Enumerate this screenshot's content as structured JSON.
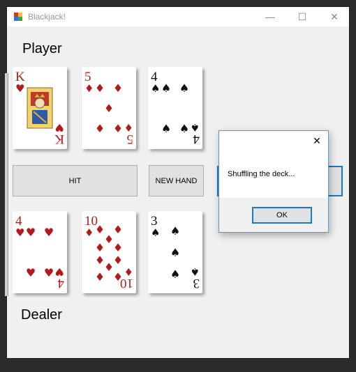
{
  "window": {
    "title": "Blackjack!",
    "minimize_glyph": "—",
    "maximize_glyph": "☐",
    "close_glyph": "✕"
  },
  "labels": {
    "player": "Player",
    "dealer": "Dealer"
  },
  "buttons": {
    "hit": "HIT",
    "new_hand": "NEW HAND"
  },
  "player_cards": [
    {
      "rank": "K",
      "suit": "♥",
      "color": "#b31b1b",
      "face": true
    },
    {
      "rank": "5",
      "suit": "♦",
      "color": "#b31b1b",
      "face": false
    },
    {
      "rank": "4",
      "suit": "♠",
      "color": "#111111",
      "face": false
    }
  ],
  "dealer_cards": [
    {
      "rank": "4",
      "suit": "♥",
      "color": "#b31b1b",
      "face": false
    },
    {
      "rank": "10",
      "suit": "♦",
      "color": "#b31b1b",
      "face": false
    },
    {
      "rank": "3",
      "suit": "♠",
      "color": "#111111",
      "face": false
    }
  ],
  "dialog": {
    "message": "Shuffling the deck...",
    "ok_label": "OK",
    "close_glyph": "✕"
  },
  "colors": {
    "accent": "#1979ca",
    "red_suit": "#b31b1b",
    "black_suit": "#111111"
  }
}
